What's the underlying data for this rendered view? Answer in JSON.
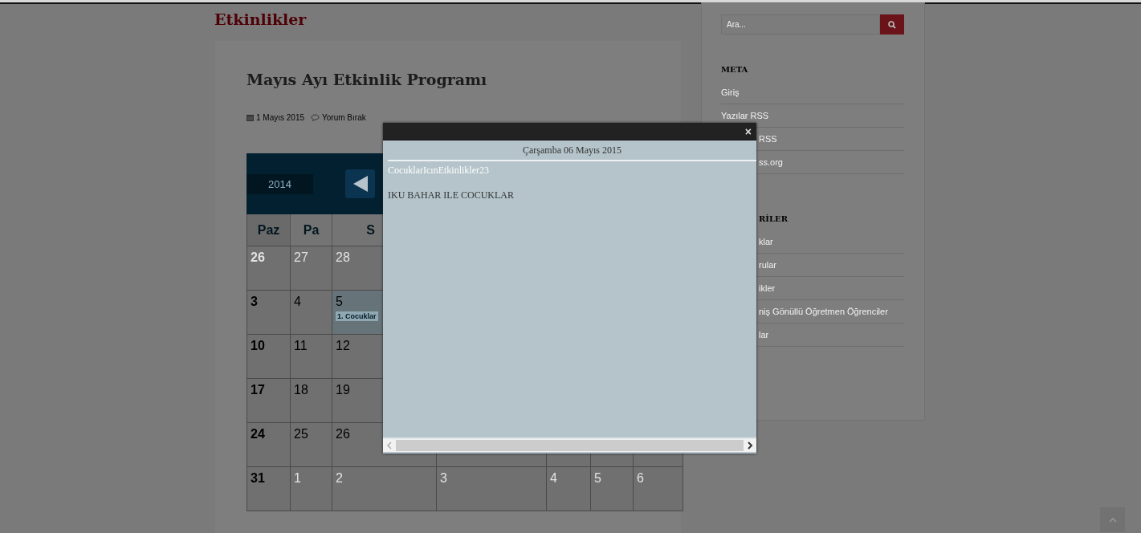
{
  "page": {
    "heading": "Etkinlikler"
  },
  "post": {
    "title": "Mayıs Ayı Etkinlik Programı",
    "date": "1 Mayıs 2015",
    "comments": "Yorum Bırak"
  },
  "calendar": {
    "year": "2014",
    "weekdays": [
      "Paz",
      "Pa",
      "S"
    ],
    "weeks": [
      [
        {
          "day": "26",
          "muted": true
        },
        {
          "day": "27",
          "muted": true
        },
        {
          "day": "28",
          "muted": true
        }
      ],
      [
        {
          "day": "3",
          "muted": false
        },
        {
          "day": "4",
          "muted": false
        },
        {
          "day": "5",
          "muted": false,
          "events": [
            "1. Cocuklar"
          ]
        }
      ],
      [
        {
          "day": "10",
          "muted": false
        },
        {
          "day": "11",
          "muted": false
        },
        {
          "day": "12",
          "muted": false
        }
      ],
      [
        {
          "day": "17",
          "muted": false
        },
        {
          "day": "18",
          "muted": false
        },
        {
          "day": "19",
          "muted": false
        }
      ],
      [
        {
          "day": "24",
          "muted": false
        },
        {
          "day": "25",
          "muted": false
        },
        {
          "day": "26",
          "muted": false
        }
      ],
      [
        {
          "day": "31",
          "muted": false
        },
        {
          "day": "1",
          "muted": true
        },
        {
          "day": "2",
          "muted": true
        },
        {
          "day": "3",
          "muted": true
        },
        {
          "day": "4",
          "muted": true
        },
        {
          "day": "5",
          "muted": true
        },
        {
          "day": "6",
          "muted": true
        }
      ]
    ]
  },
  "sidebar": {
    "search": {
      "placeholder": "Ara..."
    },
    "sections": [
      {
        "title": "META",
        "kind": "full",
        "items": [
          {
            "label": "Giriş",
            "kind": "full"
          },
          {
            "label": "Yazılar RSS",
            "kind": "full"
          },
          {
            "label": "RSS",
            "kind": "cut"
          },
          {
            "label": "ss.org",
            "kind": "cut"
          }
        ]
      },
      {
        "title": "RİLER",
        "kind": "cut",
        "items": [
          {
            "label": "klar",
            "kind": "cut"
          },
          {
            "label": "rular",
            "kind": "cut"
          },
          {
            "label": "ikler",
            "kind": "cut"
          },
          {
            "label": "niş Gönüllü Öğretmen Öğrenciler",
            "kind": "cut"
          },
          {
            "label": "lar",
            "kind": "cut"
          }
        ]
      }
    ]
  },
  "modal": {
    "close": "×",
    "date": "Çarşamba 06 Mayıs 2015",
    "event_title": "CocuklarIcınEtkinlikler23",
    "event_text": "IKU BAHAR ILE COCUKLAR"
  }
}
